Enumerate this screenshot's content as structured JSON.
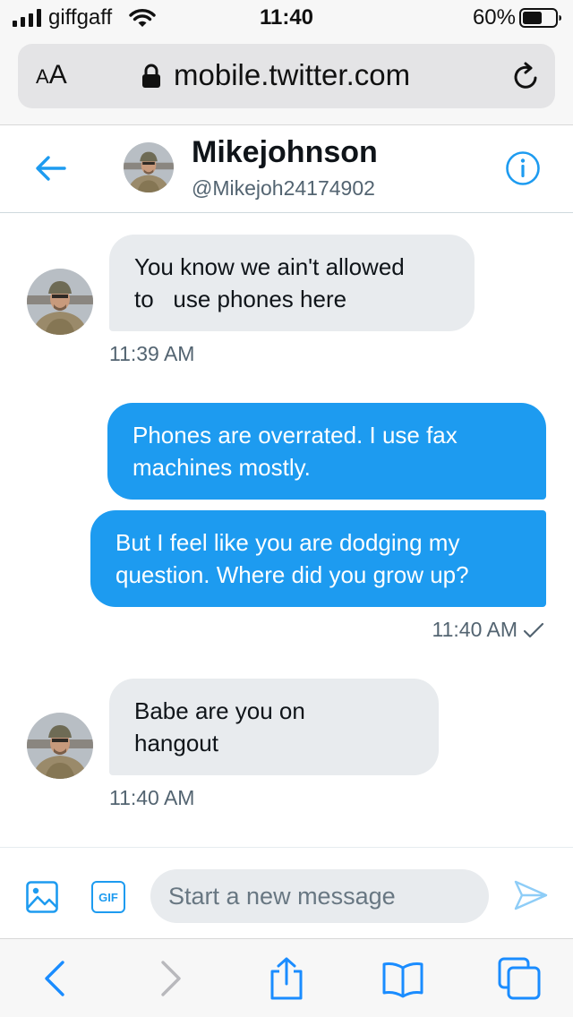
{
  "status_bar": {
    "carrier": "giffgaff",
    "time": "11:40",
    "battery_percent": "60%",
    "battery_level": 0.6,
    "icons": [
      "signal-icon",
      "wifi-icon",
      "battery-icon"
    ]
  },
  "browser": {
    "text_size_label_small": "A",
    "text_size_label_big": "A",
    "url": "mobile.twitter.com",
    "icons": [
      "lock-icon",
      "reload-icon"
    ]
  },
  "conversation": {
    "name": "Mikejohnson",
    "handle": "@Mikejoh24174902",
    "icons": [
      "back-arrow-icon",
      "info-icon"
    ]
  },
  "messages": [
    {
      "direction": "incoming",
      "lines": [
        "You know we ain't allowed",
        "to   use phones here"
      ],
      "timestamp": "11:39 AM"
    },
    {
      "direction": "outgoing",
      "lines": [
        "Phones are overrated. I use fax",
        "machines mostly."
      ]
    },
    {
      "direction": "outgoing",
      "lines": [
        "But I feel like you are dodging my",
        "question. Where did you grow up?"
      ],
      "timestamp": "11:40 AM"
    },
    {
      "direction": "incoming",
      "lines": [
        "Babe are you on",
        "hangout"
      ],
      "timestamp": "11:40 AM"
    }
  ],
  "compose": {
    "placeholder": "Start a new message",
    "gif_label": "GIF",
    "icons": [
      "image-icon",
      "gif-icon",
      "send-icon"
    ]
  },
  "toolbar": {
    "icons": [
      "back-icon",
      "forward-icon",
      "share-icon",
      "bookmarks-icon",
      "tabs-icon"
    ]
  },
  "colors": {
    "accent": "#1d9bf0",
    "incoming_bubble": "#e8ebee",
    "muted_text": "#536471"
  }
}
